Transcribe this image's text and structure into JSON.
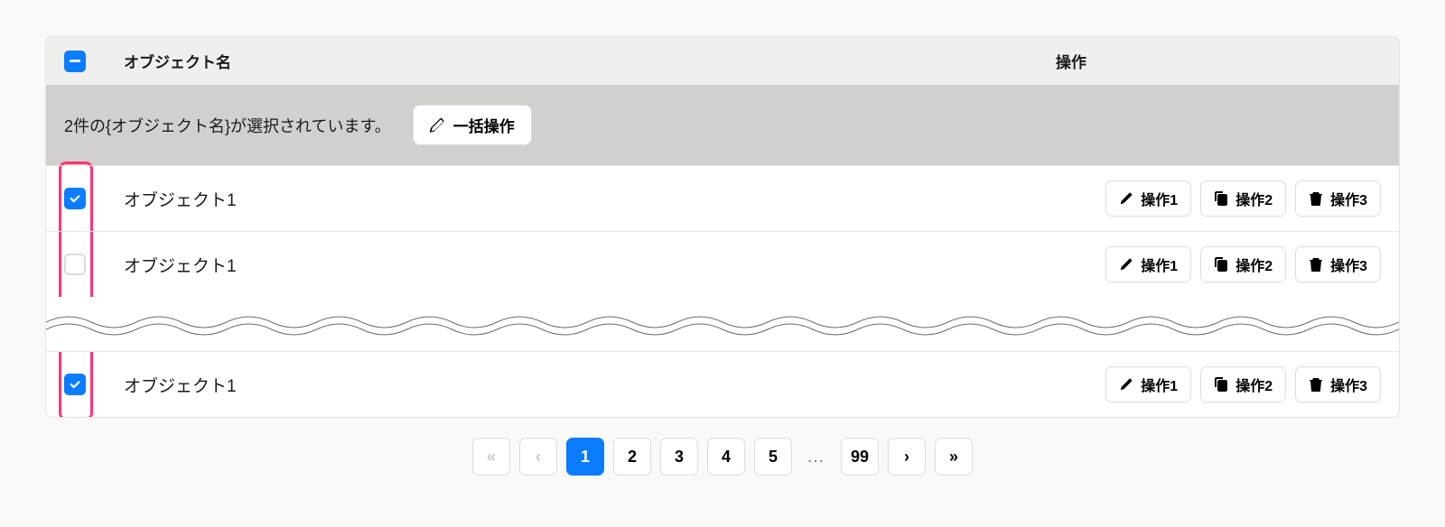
{
  "header": {
    "col_name": "オブジェクト名",
    "col_ops": "操作"
  },
  "selection_bar": {
    "message": "2件の{オブジェクト名}が選択されています。",
    "bulk_label": "一括操作"
  },
  "row_actions": {
    "op1": "操作1",
    "op2": "操作2",
    "op3": "操作3"
  },
  "rows": [
    {
      "name": "オブジェクト1",
      "checked": true
    },
    {
      "name": "オブジェクト1",
      "checked": false
    },
    {
      "name": "オブジェクト1",
      "checked": true
    }
  ],
  "pagination": {
    "pages": [
      "1",
      "2",
      "3",
      "4",
      "5"
    ],
    "ellipsis": "…",
    "last": "99",
    "active_index": 0
  },
  "colors": {
    "accent": "#0a7cff",
    "highlight": "#ff3474"
  }
}
